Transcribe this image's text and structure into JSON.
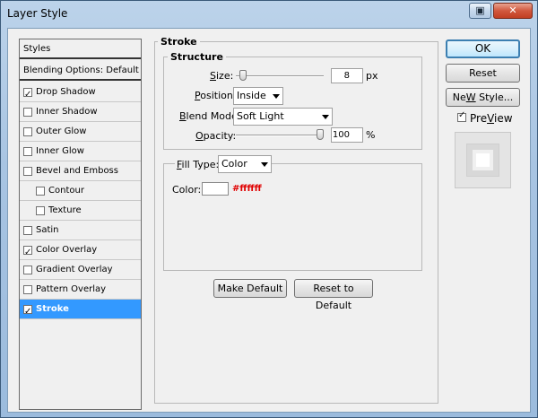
{
  "window": {
    "title": "Layer Style"
  },
  "styles_list": {
    "items": [
      {
        "label": "Styles",
        "type": "header"
      },
      {
        "label": "Blending Options: Default",
        "type": "header"
      },
      {
        "label": "Drop Shadow",
        "checked": true
      },
      {
        "label": "Inner Shadow",
        "checked": false
      },
      {
        "label": "Outer Glow",
        "checked": false
      },
      {
        "label": "Inner Glow",
        "checked": false
      },
      {
        "label": "Bevel and Emboss",
        "checked": false
      },
      {
        "label": "Contour",
        "checked": false,
        "indent": true
      },
      {
        "label": "Texture",
        "checked": false,
        "indent": true
      },
      {
        "label": "Satin",
        "checked": false
      },
      {
        "label": "Color Overlay",
        "checked": true
      },
      {
        "label": "Gradient Overlay",
        "checked": false
      },
      {
        "label": "Pattern Overlay",
        "checked": false
      },
      {
        "label": "Stroke",
        "checked": true,
        "selected": true
      }
    ]
  },
  "stroke": {
    "title": "Stroke",
    "structure": {
      "title": "Structure",
      "size_label_key": "S",
      "size_label_rest": "ize:",
      "size_value": "8",
      "size_unit": "px",
      "size_level": 0.04,
      "position_label_key": "P",
      "position_label_rest": "osition:",
      "position_value": "Inside",
      "blend_label_key": "B",
      "blend_label_rest": "lend Mode:",
      "blend_value": "Soft Light",
      "opacity_label_key": "O",
      "opacity_label_rest": "pacity:",
      "opacity_value": "100",
      "opacity_unit": "%",
      "opacity_level": 1.0
    },
    "fill": {
      "title_key": "F",
      "title_rest": "ill Type:",
      "type_value": "Color",
      "color_label": "Color:",
      "color_hex": "#ffffff",
      "color_swatch": "#ffffff"
    },
    "make_default_label": "Make Default",
    "reset_default_label": "Reset to Default"
  },
  "actions": {
    "ok_label": "OK",
    "reset_label": "Reset",
    "new_style_key": "W",
    "new_style_pre": "Ne",
    "new_style_post": " Style...",
    "preview_key": "V",
    "preview_pre": "Pre",
    "preview_post": "iew",
    "preview_checked": true
  },
  "titlebar": {
    "help_icon": "help-icon",
    "close_icon": "close-icon",
    "close_glyph": "✕",
    "help_glyph": "▣"
  }
}
